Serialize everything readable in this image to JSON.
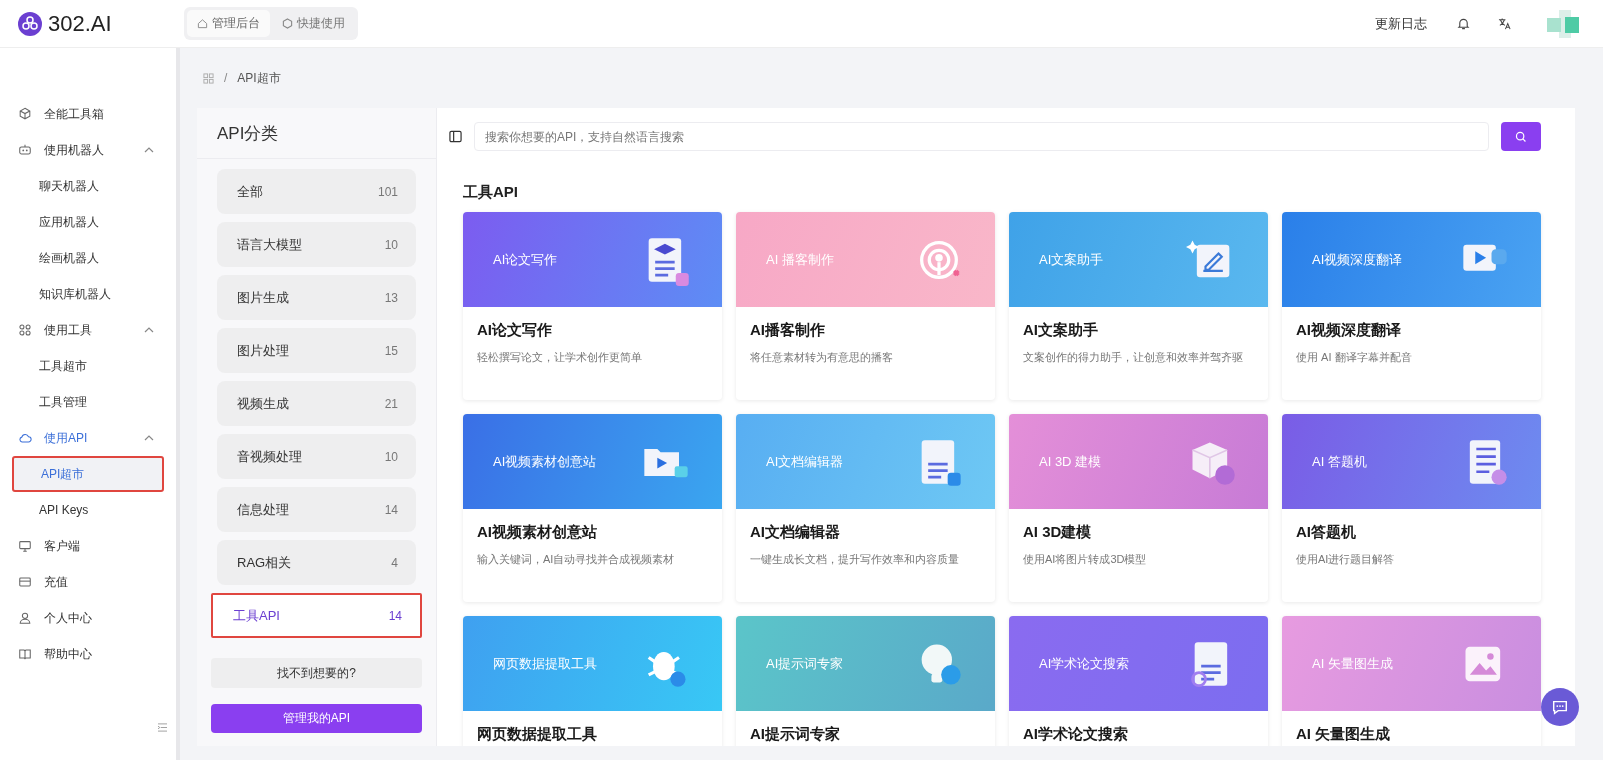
{
  "header": {
    "logo": "302.AI",
    "tabs": [
      {
        "label": "管理后台",
        "selected": true
      },
      {
        "label": "快捷使用",
        "selected": false
      }
    ],
    "changelog": "更新日志"
  },
  "sidebar": {
    "items": [
      {
        "label": "全能工具箱",
        "selected": false
      },
      {
        "label": "使用机器人",
        "expanded": true,
        "selected": false,
        "children": [
          {
            "label": "聊天机器人",
            "selected": false
          },
          {
            "label": "应用机器人",
            "selected": false
          },
          {
            "label": "绘画机器人",
            "selected": false
          },
          {
            "label": "知识库机器人",
            "selected": false
          }
        ]
      },
      {
        "label": "使用工具",
        "expanded": true,
        "selected": false,
        "children": [
          {
            "label": "工具超市",
            "selected": false
          },
          {
            "label": "工具管理",
            "selected": false
          }
        ]
      },
      {
        "label": "使用API",
        "expanded": true,
        "selected": true,
        "children": [
          {
            "label": "API超市",
            "selected": true
          },
          {
            "label": "API Keys",
            "selected": false
          }
        ]
      },
      {
        "label": "客户端",
        "selected": false
      },
      {
        "label": "充值",
        "selected": false
      },
      {
        "label": "个人中心",
        "selected": false
      },
      {
        "label": "帮助中心",
        "selected": false
      }
    ]
  },
  "breadcrumb": {
    "separator": "/",
    "current": "API超市"
  },
  "categories": {
    "title": "API分类",
    "items": [
      {
        "label": "全部",
        "count": "101",
        "selected": false
      },
      {
        "label": "语言大模型",
        "count": "10",
        "selected": false
      },
      {
        "label": "图片生成",
        "count": "13",
        "selected": false
      },
      {
        "label": "图片处理",
        "count": "15",
        "selected": false
      },
      {
        "label": "视频生成",
        "count": "21",
        "selected": false
      },
      {
        "label": "音视频处理",
        "count": "10",
        "selected": false
      },
      {
        "label": "信息处理",
        "count": "14",
        "selected": false
      },
      {
        "label": "RAG相关",
        "count": "4",
        "selected": false
      },
      {
        "label": "工具API",
        "count": "14",
        "selected": true
      }
    ],
    "not_found": "找不到想要的?",
    "manage": "管理我的API"
  },
  "search": {
    "placeholder": "搜索你想要的API，支持自然语言搜索"
  },
  "section_title": "工具API",
  "cards": [
    {
      "banner": "AI论文写作",
      "title": "AI论文写作",
      "description": "轻松撰写论文，让学术创作更简单"
    },
    {
      "banner": "AI 播客制作",
      "title": "AI播客制作",
      "description": "将任意素材转为有意思的播客"
    },
    {
      "banner": "AI文案助手",
      "title": "AI文案助手",
      "description": "文案创作的得力助手，让创意和效率并驾齐驱"
    },
    {
      "banner": "AI视频深度翻译",
      "title": "AI视频深度翻译",
      "description": "使用 AI 翻译字幕并配音"
    },
    {
      "banner": "AI视频素材创意站",
      "title": "AI视频素材创意站",
      "description": "输入关键词，AI自动寻找并合成视频素材"
    },
    {
      "banner": "AI文档编辑器",
      "title": "AI文档编辑器",
      "description": "一键生成长文档，提升写作效率和内容质量"
    },
    {
      "banner": "AI 3D 建模",
      "title": "AI 3D建模",
      "description": "使用AI将图片转成3D模型"
    },
    {
      "banner": "AI 答题机",
      "title": "AI答题机",
      "description": "使用AI进行题目解答"
    },
    {
      "banner": "网页数据提取工具",
      "title": "网页数据提取工具"
    },
    {
      "banner": "AI提示词专家",
      "title": "AI提示词专家"
    },
    {
      "banner": "AI学术论文搜索",
      "title": "AI学术论文搜索"
    },
    {
      "banner": "AI 矢量图生成",
      "title": "AI 矢量图生成"
    }
  ]
}
